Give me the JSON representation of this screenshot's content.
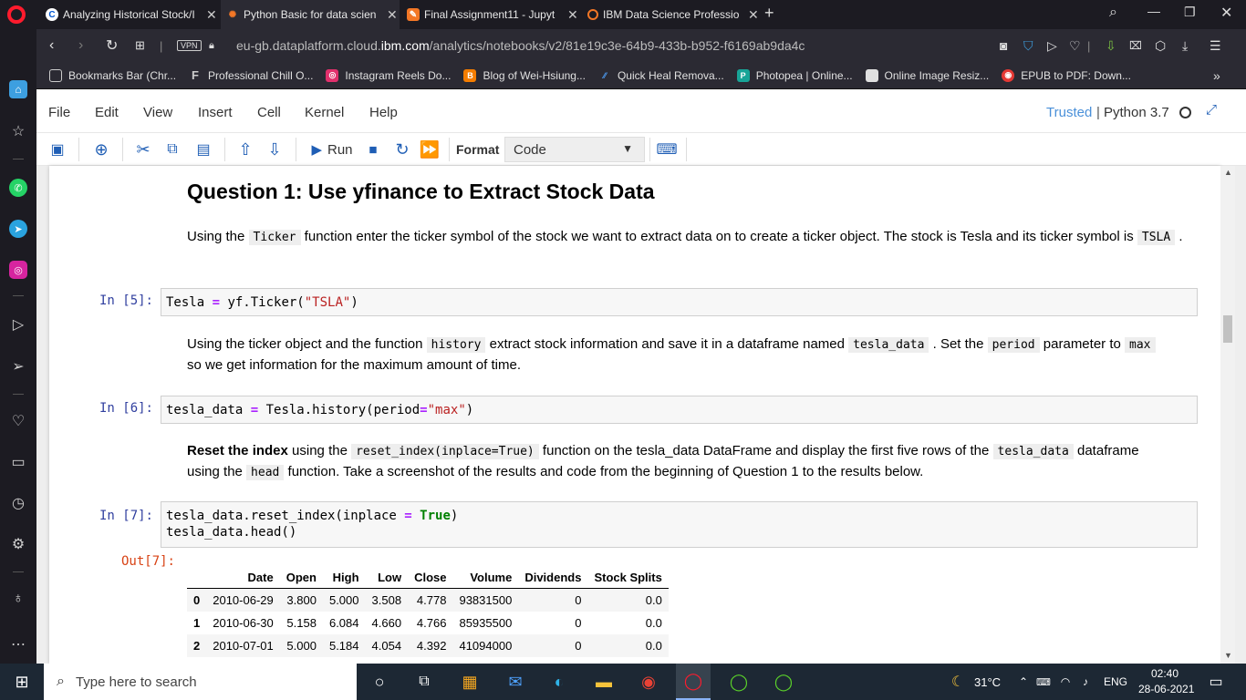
{
  "browser": {
    "tabs": [
      {
        "label": "Analyzing Historical Stock/I",
        "active": false,
        "icon": "coursera-icon"
      },
      {
        "label": "Python Basic for data scien",
        "active": true,
        "icon": "jupyter-icon"
      },
      {
        "label": "Final Assignment11 - Jupyt",
        "active": false,
        "icon": "notebook-icon"
      },
      {
        "label": "IBM Data Science Professio",
        "active": false,
        "icon": "coursera-icon"
      }
    ],
    "url_prefix": "eu-gb.dataplatform.cloud.",
    "url_domain": "ibm.com",
    "url_path": "/analytics/notebooks/v2/81e19c3e-64b9-433b-b952-f6169ab9da4c",
    "vpn_label": "VPN",
    "bookmarks": [
      {
        "label": "Bookmarks Bar (Chr...",
        "color": "#666666",
        "glyph": "□"
      },
      {
        "label": "Professional Chill O...",
        "color": "#3a3a3a",
        "glyph": "F"
      },
      {
        "label": "Instagram Reels Do...",
        "color": "#e1306c",
        "glyph": "◎"
      },
      {
        "label": "Blog of Wei-Hsiung...",
        "color": "#f57d00",
        "glyph": "B"
      },
      {
        "label": "Quick Heal Remova...",
        "color": "#1565c0",
        "glyph": "⁄"
      },
      {
        "label": "Photopea | Online...",
        "color": "#18a497",
        "glyph": "P"
      },
      {
        "label": "Online Image Resiz...",
        "color": "#e0e0e0",
        "glyph": "▇"
      },
      {
        "label": "EPUB to PDF: Down...",
        "color": "#e53935",
        "glyph": "◉"
      }
    ],
    "more_bookmarks": "»"
  },
  "jupyter": {
    "menu": [
      "File",
      "Edit",
      "View",
      "Insert",
      "Cell",
      "Kernel",
      "Help"
    ],
    "trusted": "Trusted",
    "kernel": "Python 3.7",
    "run_label": "Run",
    "format_label": "Format",
    "cell_type": "Code"
  },
  "notebook": {
    "heading": "Question 1: Use yfinance to Extract Stock Data",
    "md1_a": "Using the ",
    "md1_code1": "Ticker",
    "md1_b": " function enter the ticker symbol of the stock we want to extract data on to create a ticker object. The stock is Tesla and its ticker symbol is ",
    "md1_code2": "TSLA",
    "md1_c": " .",
    "in5_prompt": "In [5]:",
    "in5_a": "Tesla ",
    "in5_eq": "=",
    "in5_b": " yf.Ticker(",
    "in5_str": "\"TSLA\"",
    "in5_c": ")",
    "md2_a": "Using the ticker object and the function ",
    "md2_code1": "history",
    "md2_b": " extract stock information and save it in a dataframe named ",
    "md2_code2": "tesla_data",
    "md2_c": " . Set the ",
    "md2_code3": "period",
    "md2_d": " parameter to ",
    "md2_code4": "max",
    "md2_e": "so we get information for the maximum amount of time.",
    "in6_prompt": "In [6]:",
    "in6_a": "tesla_data ",
    "in6_eq": "=",
    "in6_b": " Tesla.history(period",
    "in6_eq2": "=",
    "in6_str": "\"max\"",
    "in6_c": ")",
    "md3_bold": "Reset the index",
    "md3_a": " using the ",
    "md3_code1": "reset_index(inplace=True)",
    "md3_b": " function on the tesla_data DataFrame and display the first five rows of the ",
    "md3_code2": "tesla_data",
    "md3_c": " dataframe",
    "md3_d": "using the ",
    "md3_code3": "head",
    "md3_e": " function. Take a screenshot of the results and code from the beginning of Question 1 to the results below.",
    "in7_prompt": "In [7]:",
    "in7_l1a": "tesla_data.reset_index(inplace ",
    "in7_eq": "=",
    "in7_sp": " ",
    "in7_kw": "True",
    "in7_l1b": ")",
    "in7_l2": "tesla_data.head()",
    "out7_prompt": "Out[7]:",
    "table": {
      "columns": [
        "",
        "Date",
        "Open",
        "High",
        "Low",
        "Close",
        "Volume",
        "Dividends",
        "Stock Splits"
      ],
      "rows": [
        [
          "0",
          "2010-06-29",
          "3.800",
          "5.000",
          "3.508",
          "4.778",
          "93831500",
          "0",
          "0.0"
        ],
        [
          "1",
          "2010-06-30",
          "5.158",
          "6.084",
          "4.660",
          "4.766",
          "85935500",
          "0",
          "0.0"
        ],
        [
          "2",
          "2010-07-01",
          "5.000",
          "5.184",
          "4.054",
          "4.392",
          "41094000",
          "0",
          "0.0"
        ]
      ]
    }
  },
  "taskbar": {
    "search_placeholder": "Type here to search",
    "weather": "31°C",
    "lang": "ENG",
    "time": "02:40",
    "date": "28-06-2021"
  }
}
